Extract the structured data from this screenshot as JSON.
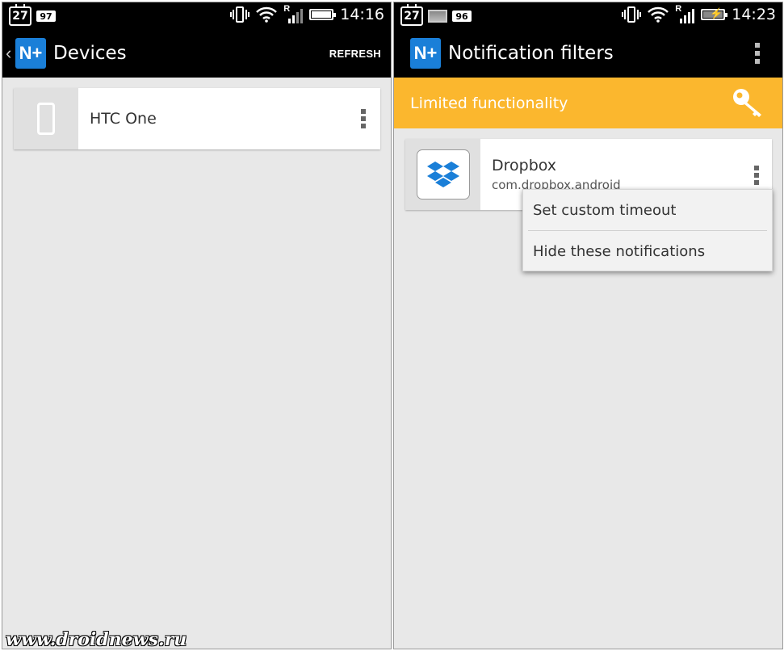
{
  "left_screen": {
    "status_bar": {
      "calendar_day": "27",
      "badge_count": "97",
      "time": "14:16",
      "icons": [
        "calendar-icon",
        "vibrate-icon",
        "wifi-icon",
        "signal-roaming-icon",
        "battery-icon"
      ]
    },
    "action_bar": {
      "logo": "N+",
      "title": "Devices",
      "action_label": "REFRESH"
    },
    "devices": [
      {
        "name": "HTC One",
        "icon": "phone-icon"
      }
    ]
  },
  "right_screen": {
    "status_bar": {
      "calendar_day": "27",
      "badge_count": "96",
      "time": "14:23",
      "icons": [
        "calendar-icon",
        "image-icon",
        "vibrate-icon",
        "wifi-icon",
        "signal-roaming-icon",
        "battery-charging-icon"
      ]
    },
    "action_bar": {
      "logo": "N+",
      "title": "Notification filters"
    },
    "banner": {
      "text": "Limited functionality",
      "icon": "key-icon",
      "color": "#fbb72e"
    },
    "apps": [
      {
        "name": "Dropbox",
        "package": "com.dropbox.android",
        "icon": "dropbox-icon"
      }
    ],
    "popup_menu": [
      "Set custom timeout",
      "Hide these notifications"
    ]
  },
  "watermark": "www.droidnews.ru",
  "colors": {
    "accent_blue": "#1a7fd8",
    "banner_yellow": "#fbb72e",
    "background": "#e8e8e8"
  }
}
